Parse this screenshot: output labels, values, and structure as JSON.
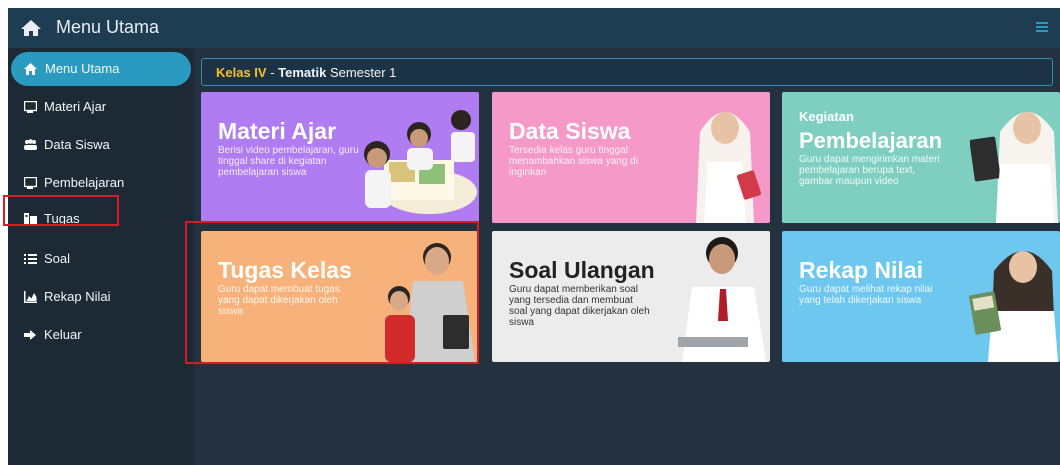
{
  "header": {
    "title": "Menu Utama",
    "home_icon": "home-icon",
    "menu_icon": "menu-icon"
  },
  "sidebar": {
    "items": [
      {
        "label": "Menu Utama",
        "icon": "home-icon",
        "active": true
      },
      {
        "label": "Materi Ajar",
        "icon": "chalkboard-icon"
      },
      {
        "label": "Data Siswa",
        "icon": "users-icon"
      },
      {
        "label": "Pembelajaran",
        "icon": "chalkboard-icon"
      },
      {
        "label": "Tugas",
        "icon": "tasks-icon",
        "highlighted": true
      },
      {
        "label": "Soal",
        "icon": "list-icon"
      },
      {
        "label": "Rekap Nilai",
        "icon": "area-chart-icon"
      },
      {
        "label": "Keluar",
        "icon": "sign-out-icon"
      }
    ]
  },
  "breadcrumb": {
    "kelas": "Kelas IV",
    "separator": " - ",
    "tema": "Tematik",
    "semester": " Semester 1"
  },
  "cards": [
    {
      "kicker": "",
      "title": "Materi Ajar",
      "desc": [
        "Berisi video pembelajaran, guru",
        "tinggal share di kegiatan",
        "pembelajaran siswa"
      ],
      "color": "#b07cf2"
    },
    {
      "kicker": "",
      "title": "Data Siswa",
      "desc": [
        "Tersedia kelas guru tinggal",
        "menambahkan siswa yang di",
        "inginkan"
      ],
      "color": "#f59ac8"
    },
    {
      "kicker": "Kegiatan",
      "title": "Pembelajaran",
      "desc": [
        "Guru dapat mengirimkan materi",
        "pembelajaran berupa text,",
        "gambar maupun video"
      ],
      "color": "#7fcfc0"
    },
    {
      "kicker": "",
      "title": "Tugas Kelas",
      "desc": [
        "Guru dapat membuat tugas",
        "yang dapat dikerjakan oleh",
        "siswa"
      ],
      "color": "#f7b27c",
      "highlighted": true
    },
    {
      "kicker": "",
      "title": "Soal Ulangan",
      "desc": [
        "Guru dapat memberikan soal",
        "yang tersedia dan membuat",
        "soal yang dapat dikerjakan oleh",
        "siswa"
      ],
      "color": "#ececec"
    },
    {
      "kicker": "",
      "title": "Rekap Nilai",
      "desc": [
        "Guru dapat melihat rekap nilai",
        "yang telah dikerjakan siswa"
      ],
      "color": "#6ec7ee"
    }
  ],
  "colors": {
    "accent": "#2a9ac1",
    "highlight": "#d11f23",
    "kelas": "#f7c21f"
  }
}
